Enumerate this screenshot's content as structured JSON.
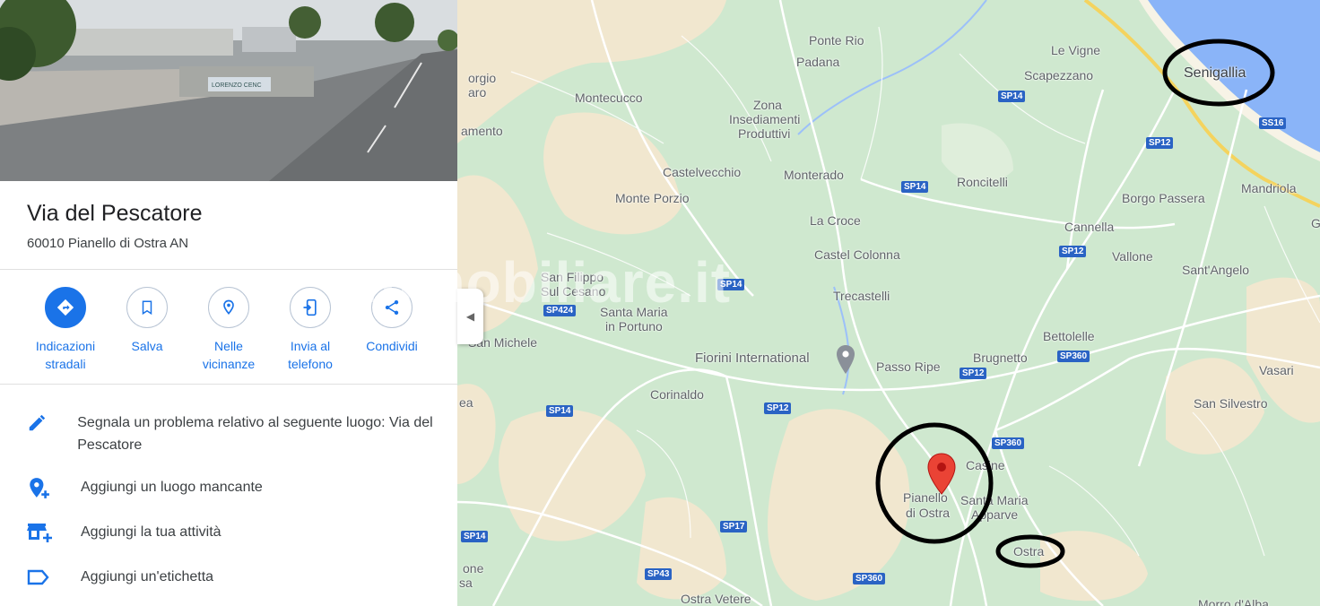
{
  "place": {
    "title": "Via del Pescatore",
    "address": "60010 Pianello di Ostra AN",
    "photo_sign": "LORENZO CENC"
  },
  "actions": [
    {
      "label": "Indicazioni stradali",
      "icon": "directions-icon"
    },
    {
      "label": "Salva",
      "icon": "bookmark-icon"
    },
    {
      "label": "Nelle vicinanze",
      "icon": "nearby-icon"
    },
    {
      "label": "Invia al telefono",
      "icon": "send-to-phone-icon"
    },
    {
      "label": "Condividi",
      "icon": "share-icon"
    }
  ],
  "menu": [
    {
      "text": "Segnala un problema relativo al seguente luogo: Via del Pescatore",
      "icon": "pencil-icon"
    },
    {
      "text": "Aggiungi un luogo mancante",
      "icon": "add-place-icon"
    },
    {
      "text": "Aggiungi la tua attività",
      "icon": "add-business-icon"
    },
    {
      "text": "Aggiungi un'etichetta",
      "icon": "label-icon"
    }
  ],
  "map": {
    "watermark": "immobiliare.it",
    "place_labels": [
      {
        "text": "Ponte Rio"
      },
      {
        "text": "Padana"
      },
      {
        "text": "Le Vigne"
      },
      {
        "text": "Scapezzano"
      },
      {
        "text": "Senigallia"
      },
      {
        "text": "orgio"
      },
      {
        "text": "aro"
      },
      {
        "text": "amento"
      },
      {
        "text": "Montecucco"
      },
      {
        "text": "Zona"
      },
      {
        "text": "Insediamenti"
      },
      {
        "text": "Produttivi"
      },
      {
        "text": "Castelvecchio"
      },
      {
        "text": "Monterado"
      },
      {
        "text": "Roncitelli"
      },
      {
        "text": "Borgo Passera"
      },
      {
        "text": "Mandriola"
      },
      {
        "text": "Monte Porzio"
      },
      {
        "text": "La Croce"
      },
      {
        "text": "Cannella"
      },
      {
        "text": "Castel Colonna"
      },
      {
        "text": "Vallone"
      },
      {
        "text": "Sant'Angelo"
      },
      {
        "text": "San Filippo"
      },
      {
        "text": "Sul Cesano"
      },
      {
        "text": "Trecastelli"
      },
      {
        "text": "Santa Maria"
      },
      {
        "text": "in Portuno"
      },
      {
        "text": "San Michele"
      },
      {
        "text": "Bettolelle"
      },
      {
        "text": "Fiorini International"
      },
      {
        "text": "Passo Ripe"
      },
      {
        "text": "Brugnetto"
      },
      {
        "text": "Vasari"
      },
      {
        "text": "Corinaldo"
      },
      {
        "text": "San Silvestro"
      },
      {
        "text": "ea"
      },
      {
        "text": "Casine"
      },
      {
        "text": "Pianello"
      },
      {
        "text": "di Ostra"
      },
      {
        "text": "Santa Maria"
      },
      {
        "text": "Apparve"
      },
      {
        "text": "Ostra"
      },
      {
        "text": "one"
      },
      {
        "text": "sa"
      },
      {
        "text": "Ostra Vetere"
      },
      {
        "text": "Morro d'Alba"
      },
      {
        "text": "G"
      }
    ],
    "road_labels": [
      {
        "text": "SP14"
      },
      {
        "text": "SS16"
      },
      {
        "text": "SP12"
      },
      {
        "text": "SP14"
      },
      {
        "text": "SP12"
      },
      {
        "text": "SP14"
      },
      {
        "text": "SP424"
      },
      {
        "text": "SP360"
      },
      {
        "text": "SP12"
      },
      {
        "text": "SP14"
      },
      {
        "text": "SP12"
      },
      {
        "text": "SP360"
      },
      {
        "text": "SP17"
      },
      {
        "text": "SP14"
      },
      {
        "text": "SP43"
      },
      {
        "text": "SP360"
      }
    ],
    "colors": {
      "land": "#cfe8cf",
      "sand": "#f1e7cf",
      "water": "#8ab4f8",
      "road": "#ffffff",
      "highway": "#f4d35e",
      "pin": "#ea4335",
      "circle": "#000000"
    }
  }
}
